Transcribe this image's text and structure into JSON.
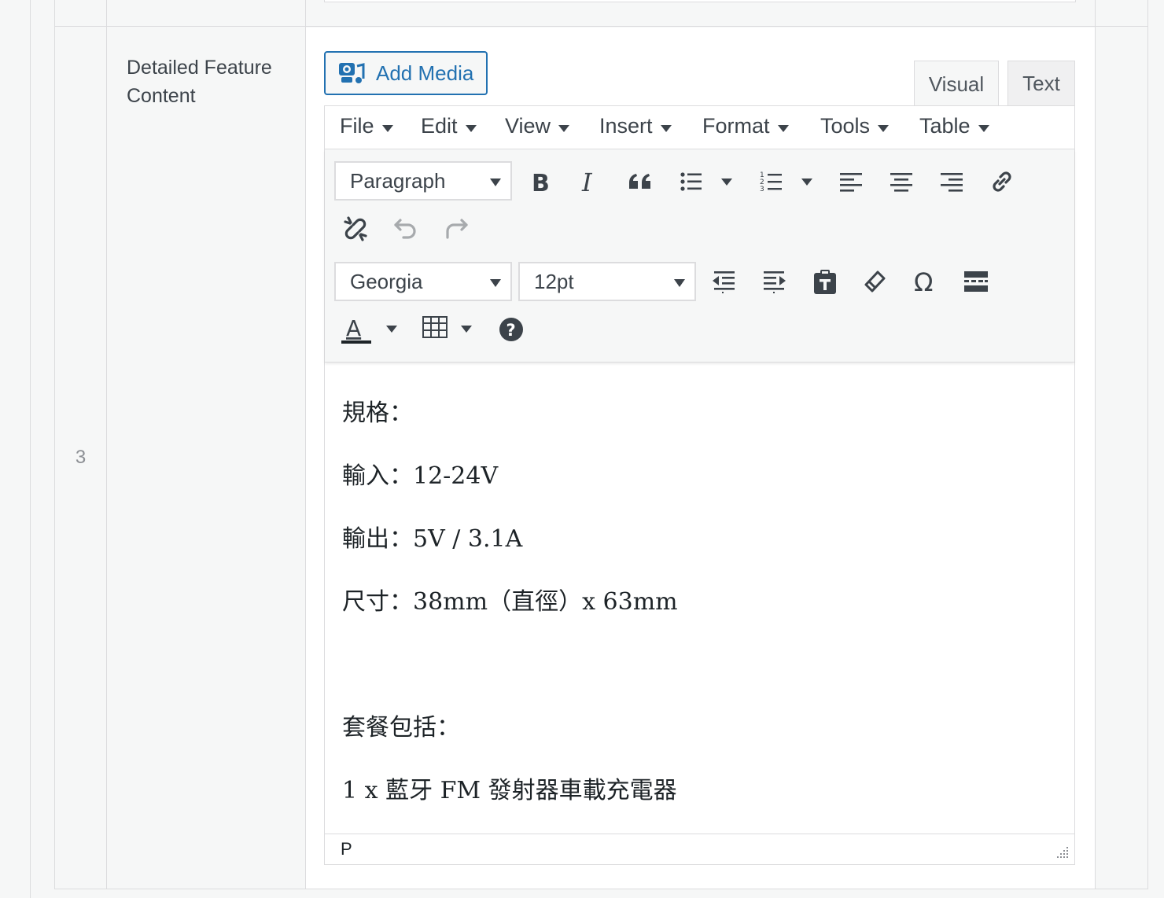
{
  "row": {
    "number": "3",
    "label": "Detailed Feature Content"
  },
  "add_media": {
    "label": "Add Media"
  },
  "tabs": {
    "visual": "Visual",
    "text": "Text"
  },
  "menubar": [
    "File",
    "Edit",
    "View",
    "Insert",
    "Format",
    "Tools",
    "Table"
  ],
  "toolbar": {
    "block_format": "Paragraph",
    "font_family": "Georgia",
    "font_size": "12pt"
  },
  "content": {
    "spec_heading": "規格：",
    "input": "輸入：12-24V",
    "output": "輸出：5V / 3.1A",
    "size": "尺寸：38mm（直徑）x 63mm",
    "package_heading": "套餐包括：",
    "package_item": "1 x 藍牙 FM 發射器車載充電器"
  },
  "status": {
    "path": "P"
  },
  "colors": {
    "accent": "#2271b1",
    "border": "#dcdcde",
    "icon": "#3c434a",
    "disabled": "#a7aaad"
  }
}
